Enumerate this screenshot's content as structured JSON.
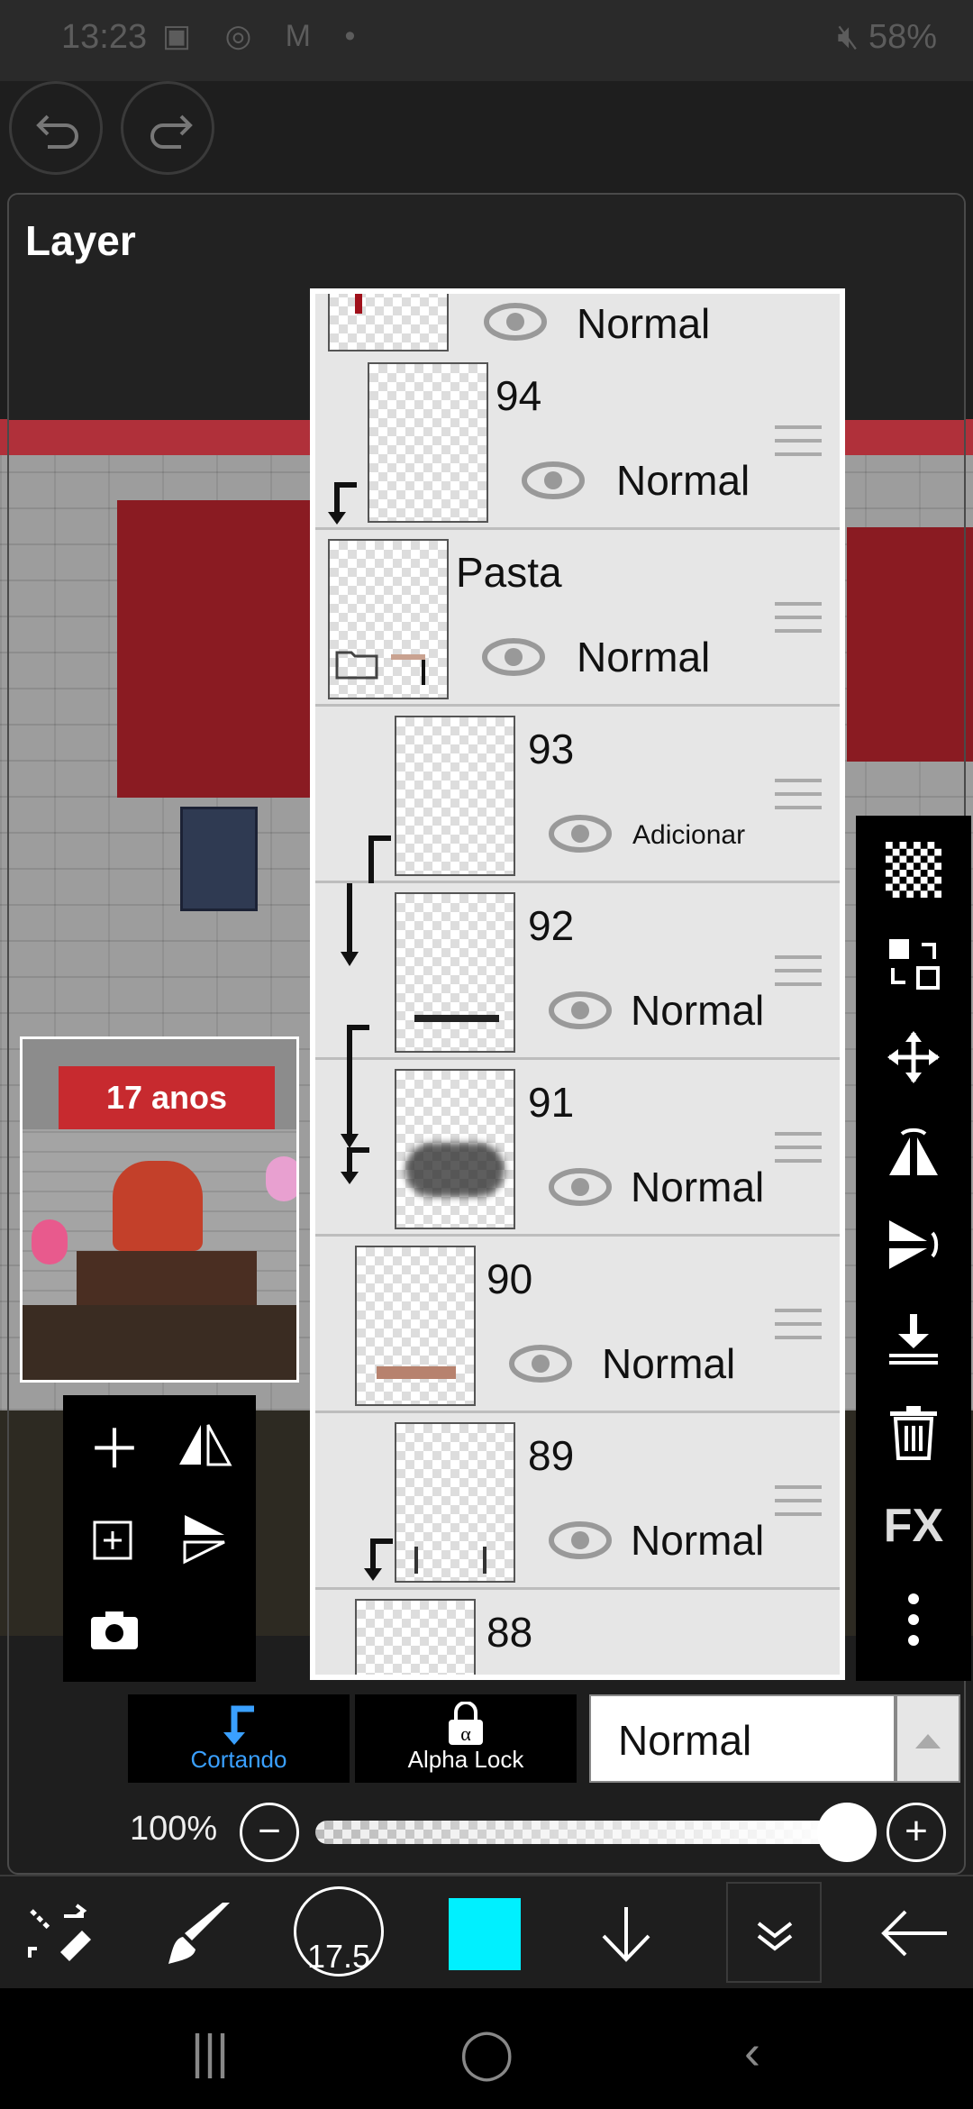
{
  "status_bar": {
    "time": "13:23",
    "left_icons": [
      "image-icon",
      "whatsapp-icon",
      "gmail-icon",
      "dot-icon"
    ],
    "battery": "58%",
    "right_icons": [
      "mute-icon",
      "wifi-icon",
      "signal-icon",
      "battery-icon"
    ]
  },
  "panel": {
    "title": "Layer"
  },
  "layers": [
    {
      "name": "",
      "blend": "Normal"
    },
    {
      "name": "94",
      "blend": "Normal"
    },
    {
      "name": "Pasta",
      "blend": "Normal"
    },
    {
      "name": "93",
      "blend": "Adicionar"
    },
    {
      "name": "92",
      "blend": "Normal"
    },
    {
      "name": "91",
      "blend": "Normal"
    },
    {
      "name": "90",
      "blend": "Normal"
    },
    {
      "name": "89",
      "blend": "Normal"
    },
    {
      "name": "88",
      "blend": ""
    }
  ],
  "right_toolbar": {
    "items": [
      "checker-icon",
      "transfer-icon",
      "move-icon",
      "flip-horizontal-icon",
      "flip-vertical-icon",
      "merge-down-icon",
      "trash-icon",
      "fx-button",
      "more-vertical-icon"
    ],
    "fx_label": "FX"
  },
  "preview": {
    "banner_text": "17 anos"
  },
  "clipping": {
    "cortando_label": "Cortando",
    "alpha_lock_label": "Alpha Lock",
    "cortando_color": "#3aa0ff"
  },
  "blend_mode": {
    "value": "Normal"
  },
  "opacity": {
    "label": "100%",
    "value": 100
  },
  "bottom_toolbar": {
    "brush_size": "17.5",
    "color": "#00f0ff"
  },
  "navbar": {
    "recent": "|||",
    "home": "◯",
    "back": "‹"
  }
}
